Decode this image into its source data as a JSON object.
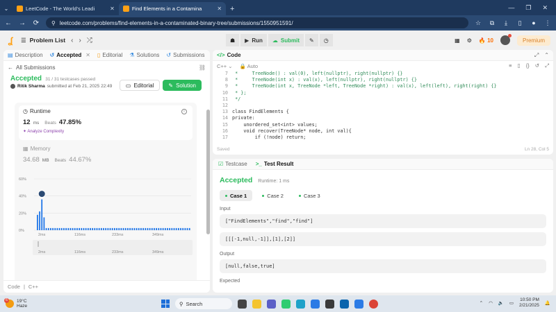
{
  "browser": {
    "tabs": [
      {
        "title": "LeetCode - The World's Leadi",
        "active": false
      },
      {
        "title": "Find Elements in a Contamina",
        "active": true
      }
    ],
    "url": "leetcode.com/problems/find-elements-in-a-contaminated-binary-tree/submissions/1550951591/"
  },
  "lcnav": {
    "problem_list": "Problem List",
    "run": "Run",
    "submit": "Submit",
    "streak": "10",
    "premium": "Premium"
  },
  "left": {
    "tabs": [
      "Description",
      "Accepted",
      "Editorial",
      "Solutions",
      "Submissions"
    ],
    "all_submissions": "All Submissions",
    "status": "Accepted",
    "testcases": "31 / 31 testcases passed",
    "user": "Ritik Sharma",
    "submitted_at": "submitted at Feb 21, 2025 22:49",
    "editorial_btn": "Editorial",
    "solution_btn": "Solution",
    "runtime": {
      "title": "Runtime",
      "value": "12",
      "unit": "ms",
      "beats_label": "Beats",
      "beats": "47.85%",
      "analyze": "Analyze Complexity"
    },
    "memory": {
      "title": "Memory",
      "value": "34.68",
      "unit": "MB",
      "beats_label": "Beats",
      "beats": "44.67%"
    },
    "footer": {
      "code": "Code",
      "lang": "C++"
    }
  },
  "chart_data": {
    "type": "bar",
    "yticks": [
      "60%",
      "40%",
      "20%",
      "0%"
    ],
    "xticks": [
      "2ms",
      "116ms",
      "233ms",
      "349ms"
    ],
    "ylim": [
      0,
      60
    ],
    "values": [
      18,
      22,
      36,
      15,
      2.5,
      2.5,
      2.5,
      2.5,
      2.5,
      2.5,
      2.5,
      2.5,
      2.5,
      2.5,
      2.5,
      2.5,
      2.5,
      2.5,
      2.5,
      2.5,
      2.5,
      2.5,
      2.5,
      2.5,
      2.5,
      2.5,
      2.5,
      2.5,
      2.5,
      2.5,
      2.5,
      2.5,
      2.5,
      2.5,
      2.5,
      2.5,
      2.5,
      2.5,
      2.5,
      2.5,
      2.5,
      2.5,
      2.5,
      2.5,
      2.5,
      2.5,
      2.5,
      2.5,
      2.5,
      2.5,
      2.5,
      2.5,
      2.5,
      2.5,
      2.5,
      2.5,
      2.5,
      2.5,
      2.5,
      2.5,
      2.5,
      2.5,
      2.5,
      2.5,
      2.5,
      2.5,
      2.5,
      2.5,
      2.5,
      2.5
    ],
    "highlight_index": 2,
    "brush_xticks": [
      "2ms",
      "116ms",
      "233ms",
      "349ms"
    ],
    "bar_color": "#1a73e8"
  },
  "code": {
    "title": "Code",
    "lang": "C++",
    "mode": "Auto",
    "lines": [
      {
        "n": "7",
        "t": " *     TreeNode() : val(0), left(nullptr), right(nullptr) {}"
      },
      {
        "n": "8",
        "t": " *     TreeNode(int x) : val(x), left(nullptr), right(nullptr) {}"
      },
      {
        "n": "9",
        "t": " *     TreeNode(int x, TreeNode *left, TreeNode *right) : val(x), left(left), right(right) {}"
      },
      {
        "n": "10",
        "t": " * };"
      },
      {
        "n": "11",
        "t": " */"
      },
      {
        "n": "12",
        "t": ""
      },
      {
        "n": "13",
        "t": "class FindElements {"
      },
      {
        "n": "14",
        "t": "private:"
      },
      {
        "n": "15",
        "t": "    unordered_set<int> values;"
      },
      {
        "n": "16",
        "t": "    void recover(TreeNode* node, int val){"
      },
      {
        "n": "17",
        "t": "        if (!node) return;"
      }
    ],
    "saved": "Saved",
    "cursor": "Ln 28, Col 5"
  },
  "test": {
    "tab_testcase": "Testcase",
    "tab_result": "Test Result",
    "status": "Accepted",
    "runtime": "Runtime: 1 ms",
    "cases": [
      "Case 1",
      "Case 2",
      "Case 3"
    ],
    "input_label": "Input",
    "input1": "[\"FindElements\",\"find\",\"find\"]",
    "input2": "[[[-1,null,-1]],[1],[2]]",
    "output_label": "Output",
    "output": "[null,false,true]",
    "expected_label": "Expected"
  },
  "taskbar": {
    "temp": "19°C",
    "weather": "Haze",
    "search": "Search",
    "time": "10:50 PM",
    "date": "2/21/2025"
  }
}
